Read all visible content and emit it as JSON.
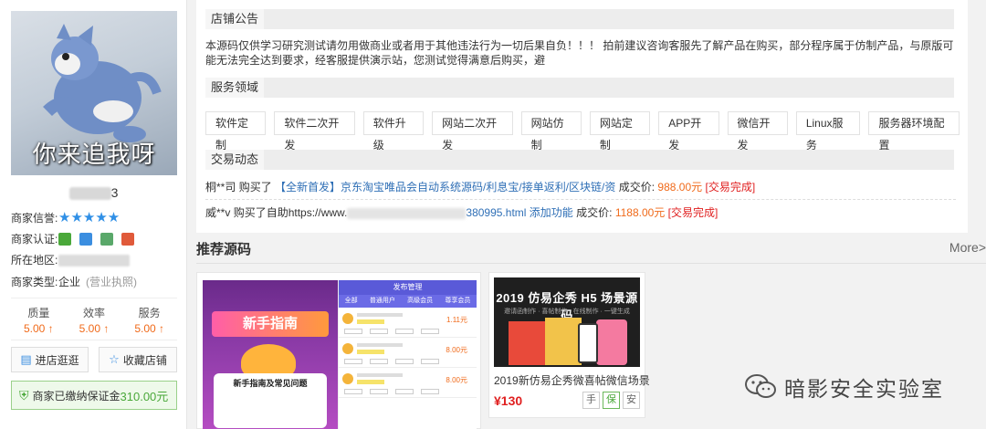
{
  "sidebar": {
    "avatar_caption": "你来追我呀",
    "shop_name_suffix": "3",
    "reputation": {
      "label": "商家信誉:",
      "stars": "★★★★★",
      "rating": 5
    },
    "certification": {
      "label": "商家认证:",
      "icons": [
        "id-card-icon",
        "mail-icon",
        "phone-icon",
        "shield-icon"
      ]
    },
    "location": {
      "label": "所在地区:"
    },
    "merchant_type": {
      "label": "商家类型:",
      "value": "企业",
      "note": "(营业执照)"
    },
    "scores": [
      {
        "label": "质量",
        "value": "5.00 ↑"
      },
      {
        "label": "效率",
        "value": "5.00 ↑"
      },
      {
        "label": "服务",
        "value": "5.00 ↑"
      }
    ],
    "visit_button": "进店逛逛",
    "favorite_button": "收藏店铺",
    "deposit": {
      "text": "商家已缴纳保证金",
      "amount": "310.00元"
    }
  },
  "main": {
    "notice_title": "店铺公告",
    "notice_text": "本源码仅供学习研究测试请勿用做商业或者用于其他违法行为一切后果自负！！！ 拍前建议咨询客服先了解产品在购买，部分程序属于仿制产品，与原版可能无法完全达到要求，经客服提供演示站，您测试觉得满意后购买，避",
    "service_title": "服务领域",
    "services": [
      "软件定制",
      "软件二次开发",
      "软件升级",
      "网站二次开发",
      "网站仿制",
      "网站定制",
      "APP开发",
      "微信开发",
      "Linux服务",
      "服务器环境配置"
    ],
    "trade_title": "交易动态",
    "trades": [
      {
        "buyer": "桐**司",
        "action": "购买了",
        "product": "【全新首发】京东淘宝唯品会自动系统源码/利息宝/接单返利/区块链/资",
        "price_label": "成交价:",
        "price": "988.00元",
        "status": "[交易完成]"
      },
      {
        "buyer": "威**v",
        "action": "购买了自助https://www.",
        "product": "380995.html 添加功能",
        "price_label": "成交价:",
        "price": "1188.00元",
        "status": "[交易完成]"
      }
    ],
    "recommend_title": "推荐源码",
    "more": "More>",
    "products": [
      {
        "thumb_banner": "新手指南",
        "thumb_box_title": "新手指南及常见问题",
        "thumb_header": "发布管理",
        "thumb_tabs": [
          "全部",
          "普通用户",
          "高级会员",
          "尊享会员"
        ],
        "thumb_rows": [
          {
            "price": "1.11元"
          },
          {
            "price": "8.00元"
          },
          {
            "price": "8.00元"
          }
        ]
      },
      {
        "thumb_title": "2019 仿易企秀 H5 场景源码",
        "thumb_subtitle": "邀请函制作 · 喜帖制作 · 在线制作 · 一键生成",
        "title": "2019新仿易企秀微喜帖微信场景",
        "price": "¥130",
        "badges": [
          "手",
          "保",
          "安"
        ]
      }
    ]
  },
  "watermark": "暗影安全实验室",
  "colors": {
    "accent_blue": "#2f8fe6",
    "price_orange": "#f06a1a",
    "done_red": "#e02020",
    "deposit_green": "#4aa83a"
  }
}
